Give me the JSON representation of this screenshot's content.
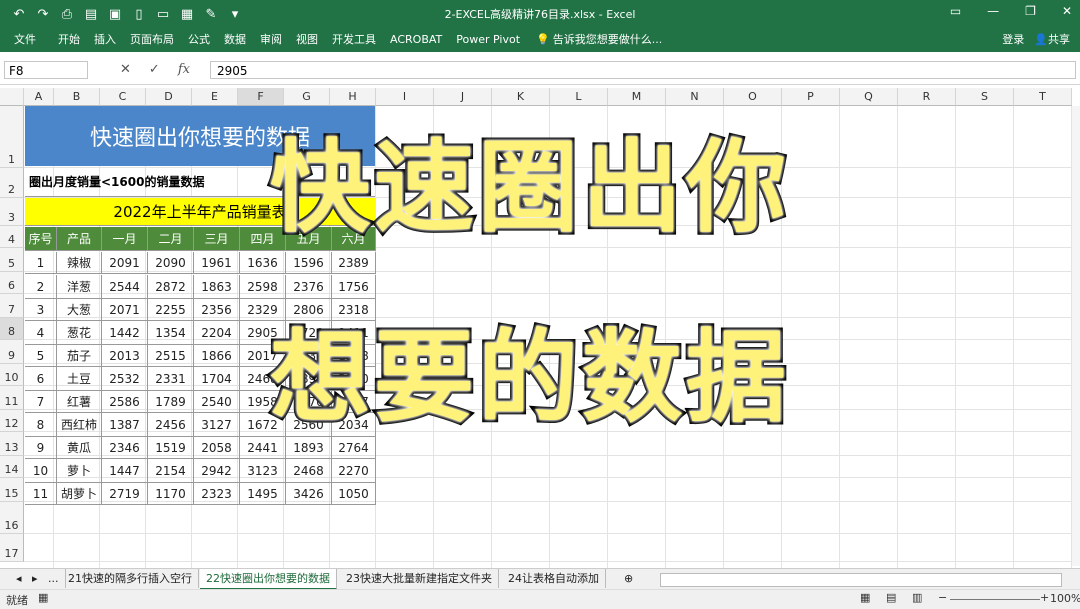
{
  "title_bar": {
    "document_title": "2-EXCEL高级精讲76目录.xlsx - Excel",
    "qat_icons": [
      "undo-icon",
      "redo-icon",
      "print-preview-icon",
      "print-icon",
      "save-icon",
      "new-icon",
      "open-icon",
      "clipboard-icon",
      "brush-icon",
      "more-icon"
    ]
  },
  "ribbon": {
    "tabs": [
      "文件",
      "开始",
      "插入",
      "页面布局",
      "公式",
      "数据",
      "审阅",
      "视图",
      "开发工具",
      "ACROBAT",
      "Power Pivot"
    ],
    "tell_me": "告诉我您想要做什么...",
    "signin": "登录",
    "share": "共享"
  },
  "formula_bar": {
    "name_box": "F8",
    "fx": "fx",
    "value": "2905"
  },
  "columns": [
    "A",
    "B",
    "C",
    "D",
    "E",
    "F",
    "G",
    "H",
    "I",
    "J",
    "K",
    "L",
    "M",
    "N",
    "O",
    "P",
    "Q",
    "R",
    "S",
    "T"
  ],
  "rows": [
    "1",
    "2",
    "3",
    "4",
    "5",
    "6",
    "7",
    "8",
    "9",
    "10",
    "11",
    "12",
    "13",
    "14",
    "15",
    "16",
    "17"
  ],
  "sheet": {
    "banner": "快速圈出你想要的数据",
    "row2_text": "圈出月度销量<1600的销量数据",
    "row3_text": "2022年上半年产品销量表",
    "headers": [
      "序号",
      "产品",
      "一月",
      "二月",
      "三月",
      "四月",
      "五月",
      "六月"
    ],
    "table": [
      [
        "1",
        "辣椒",
        "2091",
        "2090",
        "1961",
        "1636",
        "1596",
        "2389"
      ],
      [
        "2",
        "洋葱",
        "2544",
        "2872",
        "1863",
        "2598",
        "2376",
        "1756"
      ],
      [
        "3",
        "大葱",
        "2071",
        "2255",
        "2356",
        "2329",
        "2806",
        "2318"
      ],
      [
        "4",
        "葱花",
        "1442",
        "1354",
        "2204",
        "2905",
        "1720",
        "2411"
      ],
      [
        "5",
        "茄子",
        "2013",
        "2515",
        "1866",
        "2017",
        "2130",
        "1588"
      ],
      [
        "6",
        "土豆",
        "2532",
        "2331",
        "1704",
        "2468",
        "2896",
        "2140"
      ],
      [
        "7",
        "红薯",
        "2586",
        "1789",
        "2540",
        "1958",
        "2270",
        "1467"
      ],
      [
        "8",
        "西红柿",
        "1387",
        "2456",
        "3127",
        "1672",
        "2560",
        "2034"
      ],
      [
        "9",
        "黄瓜",
        "2346",
        "1519",
        "2058",
        "2441",
        "1893",
        "2764"
      ],
      [
        "10",
        "萝卜",
        "1447",
        "2154",
        "2942",
        "3123",
        "2468",
        "2270"
      ],
      [
        "11",
        "胡萝卜",
        "2719",
        "1170",
        "2323",
        "1495",
        "3426",
        "1050"
      ]
    ]
  },
  "overlay": {
    "line1": "快速圈出你",
    "line2": "想要的数据"
  },
  "sheet_tabs": [
    "...",
    "21快速的隔多行插入空行",
    "22快速圈出你想要的数据",
    "23快速大批量新建指定文件夹",
    "24让表格自动添加"
  ],
  "status": {
    "left": "就绪",
    "zoom": "100%"
  }
}
